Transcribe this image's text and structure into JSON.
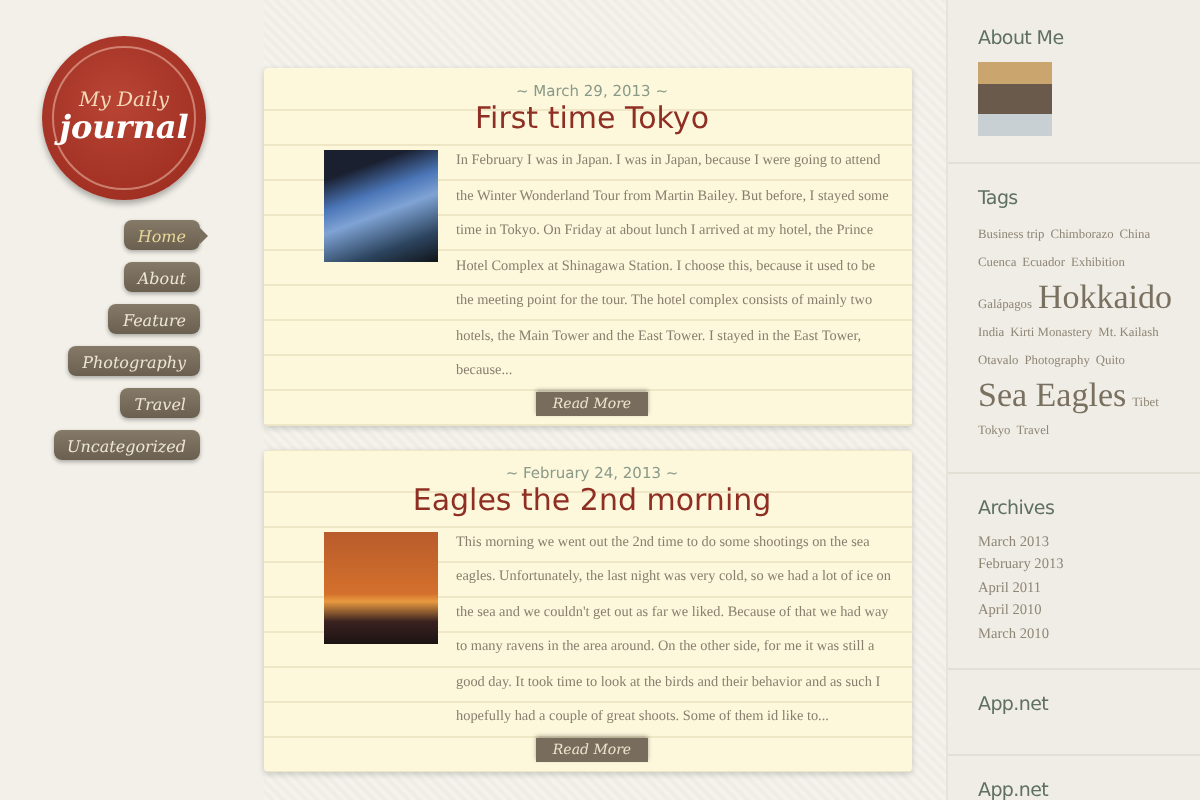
{
  "logo": {
    "line1": "My Daily",
    "line2": "journal"
  },
  "nav": [
    {
      "label": "Home",
      "selected": true
    },
    {
      "label": "About",
      "selected": false
    },
    {
      "label": "Feature",
      "selected": false
    },
    {
      "label": "Photography",
      "selected": false
    },
    {
      "label": "Travel",
      "selected": false
    },
    {
      "label": "Uncategorized",
      "selected": false
    }
  ],
  "posts": [
    {
      "date": "~ March 29, 2013 ~",
      "title": "First time Tokyo",
      "kind": "buildings",
      "excerpt": "In February I was in Japan. I was in Japan, because I were going to attend the Winter Wonderland Tour from Martin Bailey. But before, I stayed some time in Tokyo. On Friday at about lunch I arrived at my hotel, the Prince Hotel Complex at Shinagawa Station. I choose this, because it used to be the meeting point for the tour. The hotel complex consists of mainly two hotels, the Main Tower and the East Tower. I stayed in the East Tower, because...",
      "button": "Read More"
    },
    {
      "date": "~ February 24, 2013 ~",
      "title": "Eagles the 2nd morning",
      "kind": "eagle",
      "excerpt": "This morning we went out the 2nd time to do some shootings on the sea eagles. Unfortunately, the last night was very cold, so we had a lot of ice on the sea and we couldn't get out as far we liked. Because of that we had way to many ravens in the area around. On the other side, for me it was still a good day. It took time to look at the birds and their behavior and as such I hopefully had a couple of great shoots. Some of them id like to...",
      "button": "Read More"
    }
  ],
  "sidebar": {
    "about": {
      "heading": "About Me"
    },
    "tags": {
      "heading": "Tags",
      "items": [
        {
          "label": "Business trip",
          "kind": "small"
        },
        {
          "label": "Chimborazo",
          "kind": "small"
        },
        {
          "label": "China",
          "kind": "small"
        },
        {
          "label": "Cuenca",
          "kind": "small"
        },
        {
          "label": "Ecuador",
          "kind": "small"
        },
        {
          "label": "Exhibition",
          "kind": "small"
        },
        {
          "label": "Galápagos",
          "kind": "small"
        },
        {
          "label": "Hokkaido",
          "kind": "large"
        },
        {
          "label": "India",
          "kind": "small"
        },
        {
          "label": "Kirti Monastery",
          "kind": "small"
        },
        {
          "label": "Mt. Kailash",
          "kind": "small"
        },
        {
          "label": "Otavalo",
          "kind": "small"
        },
        {
          "label": "Photography",
          "kind": "small"
        },
        {
          "label": "Quito",
          "kind": "small"
        },
        {
          "label": "Sea Eagles",
          "kind": "large"
        },
        {
          "label": "Tibet",
          "kind": "small"
        },
        {
          "label": "Tokyo",
          "kind": "small"
        },
        {
          "label": "Travel",
          "kind": "small"
        }
      ]
    },
    "archives": {
      "heading": "Archives",
      "items": [
        "March 2013",
        "February 2013",
        "April 2011",
        "April 2010",
        "March 2010"
      ]
    },
    "widgets": [
      "App.net",
      "App.net"
    ]
  }
}
